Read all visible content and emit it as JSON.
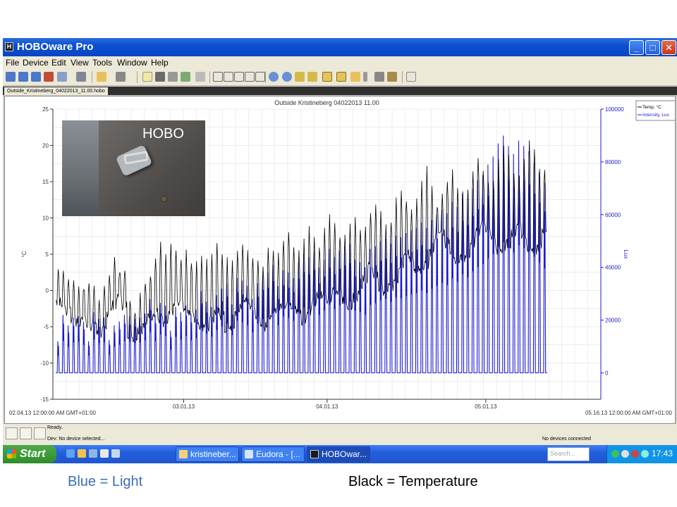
{
  "window": {
    "title": "HOBOware Pro",
    "app_icon_glyph": "H",
    "min_glyph": "_",
    "max_glyph": "□",
    "close_glyph": "✕"
  },
  "menu": [
    "File",
    "Device",
    "Edit",
    "View",
    "Tools",
    "Window",
    "Help"
  ],
  "document_tab": "Outside_Kristineberg_04022013_11.00.hobo",
  "chart_data": {
    "type": "line",
    "title": "Outside Kristineberg 04022013 11.00",
    "left_axis": {
      "label": "°C",
      "range": [
        -15,
        25
      ],
      "ticks": [
        -15,
        -10,
        -5,
        0,
        5,
        10,
        15,
        20,
        25
      ]
    },
    "right_axis": {
      "label": "Lux",
      "range": [
        -10000,
        100000
      ],
      "ticks": [
        0,
        20000,
        40000,
        60000,
        80000,
        100000
      ]
    },
    "x_start_label": "02.04.13 12:00:00 AM GMT+01:00",
    "x_end_label": "05.16.13 12:00:00 AM GMT+01:00",
    "x_ticks": [
      "03.01.13",
      "04.01.13",
      "05.01.13"
    ],
    "grid": true,
    "legend_position": "top-right",
    "series": [
      {
        "name": "Temp, °C",
        "axis": "left",
        "color": "#000000",
        "daily_min": [
          -1.5,
          -2.0,
          -3.0,
          -4.0,
          -4.5,
          -3.5,
          -5.0,
          -4.5,
          -6.0,
          -5.5,
          -3.0,
          -2.0,
          -1.0,
          -2.0,
          -6.0,
          -6.5,
          -5.5,
          -4.5,
          -3.5,
          -3.0,
          -4.0,
          -5.0,
          -3.5,
          -2.0,
          -1.5,
          -2.5,
          -3.0,
          -4.0,
          -5.0,
          -5.0,
          -4.0,
          -3.0,
          -3.5,
          -5.5,
          -5.0,
          -3.0,
          -2.0,
          -1.5,
          -2.0,
          -3.5,
          -5.0,
          -4.5,
          -3.0,
          -2.5,
          -2.0,
          -1.5,
          -2.0,
          -3.0,
          -4.5,
          -3.0,
          -1.5,
          -0.5,
          -1.0,
          -1.5,
          0.0,
          0.0,
          -1.5,
          -2.0,
          -1.0,
          0.0,
          1.5,
          3.5,
          2.0,
          0.5,
          -0.5,
          0.5,
          1.5,
          3.5,
          5.5,
          4.0,
          3.0,
          2.5,
          3.5,
          5.0,
          7.5,
          8.0,
          6.5,
          5.0,
          4.0,
          4.5,
          5.0,
          6.5,
          8.0,
          9.5,
          8.5,
          7.0,
          5.5,
          5.5,
          6.5,
          8.0,
          9.0,
          7.5,
          6.0,
          5.5,
          6.0,
          8.5
        ],
        "daily_max": [
          3.0,
          2.5,
          2.0,
          1.5,
          0.5,
          0.5,
          1.5,
          0.0,
          -1.0,
          0.0,
          2.5,
          4.5,
          3.0,
          2.5,
          -1.5,
          -2.5,
          -0.5,
          1.0,
          2.5,
          4.5,
          6.5,
          5.0,
          6.5,
          5.5,
          4.0,
          5.0,
          4.0,
          3.5,
          5.0,
          4.5,
          5.0,
          6.0,
          5.5,
          4.0,
          3.5,
          5.0,
          6.5,
          5.0,
          4.0,
          4.5,
          4.0,
          6.0,
          5.0,
          5.0,
          7.5,
          8.0,
          6.5,
          5.0,
          7.0,
          8.5,
          7.5,
          6.0,
          8.0,
          10.0,
          9.5,
          8.0,
          7.5,
          9.0,
          10.5,
          9.0,
          8.5,
          10.0,
          12.0,
          10.5,
          9.0,
          10.0,
          13.0,
          14.0,
          12.5,
          11.0,
          12.5,
          15.0,
          16.5,
          14.0,
          12.0,
          13.0,
          15.5,
          17.0,
          14.5,
          13.0,
          14.0,
          16.0,
          18.0,
          16.0,
          14.5,
          15.0,
          17.5,
          20.0,
          18.0,
          15.5,
          16.0,
          18.5,
          21.0,
          19.5,
          16.5,
          17.0
        ]
      },
      {
        "name": "Intensity, Lux",
        "axis": "right",
        "color": "#1c1ccf",
        "daily_peak": [
          12000,
          22000,
          18000,
          21000,
          21500,
          19500,
          12000,
          23000,
          20500,
          21000,
          12500,
          18000,
          19500,
          22000,
          21500,
          20500,
          21000,
          22500,
          28000,
          22000,
          26500,
          25500,
          16000,
          25000,
          23000,
          25500,
          22500,
          24000,
          31000,
          27000,
          25000,
          29500,
          32000,
          34000,
          26000,
          36000,
          35000,
          33000,
          28000,
          34000,
          37000,
          38000,
          41000,
          33000,
          39000,
          38000,
          36000,
          42000,
          45000,
          44000,
          46000,
          40000,
          43000,
          47000,
          44000,
          46500,
          48000,
          49000,
          43000,
          42000,
          40000,
          47000,
          48000,
          50000,
          51000,
          49000,
          52000,
          51500,
          53000,
          54000,
          55000,
          57000,
          55000,
          58000,
          60000,
          62000,
          60500,
          65000,
          63000,
          68000,
          66000,
          70000,
          73000,
          75000,
          79000,
          82000,
          87000,
          90000,
          86000,
          83000,
          88000,
          86000,
          84000,
          80000,
          76000,
          72000
        ]
      }
    ]
  },
  "status": {
    "ready": "Ready.",
    "device": "Dev: No device selected...",
    "connection": "No devices connected"
  },
  "taskbar": {
    "start": "Start",
    "tasks": [
      "kristineber...",
      "Eudora - [...",
      "HOBOwar..."
    ],
    "search_placeholder": "Search...",
    "clock": "17:43"
  },
  "photo": {
    "caption": "HOBO"
  },
  "notes": {
    "blue": "Blue = Light",
    "black": "Black = Temperature"
  },
  "colors": {
    "temp": "#000000",
    "light": "#1c1ccf",
    "title_bar": "#0a4fd1"
  }
}
